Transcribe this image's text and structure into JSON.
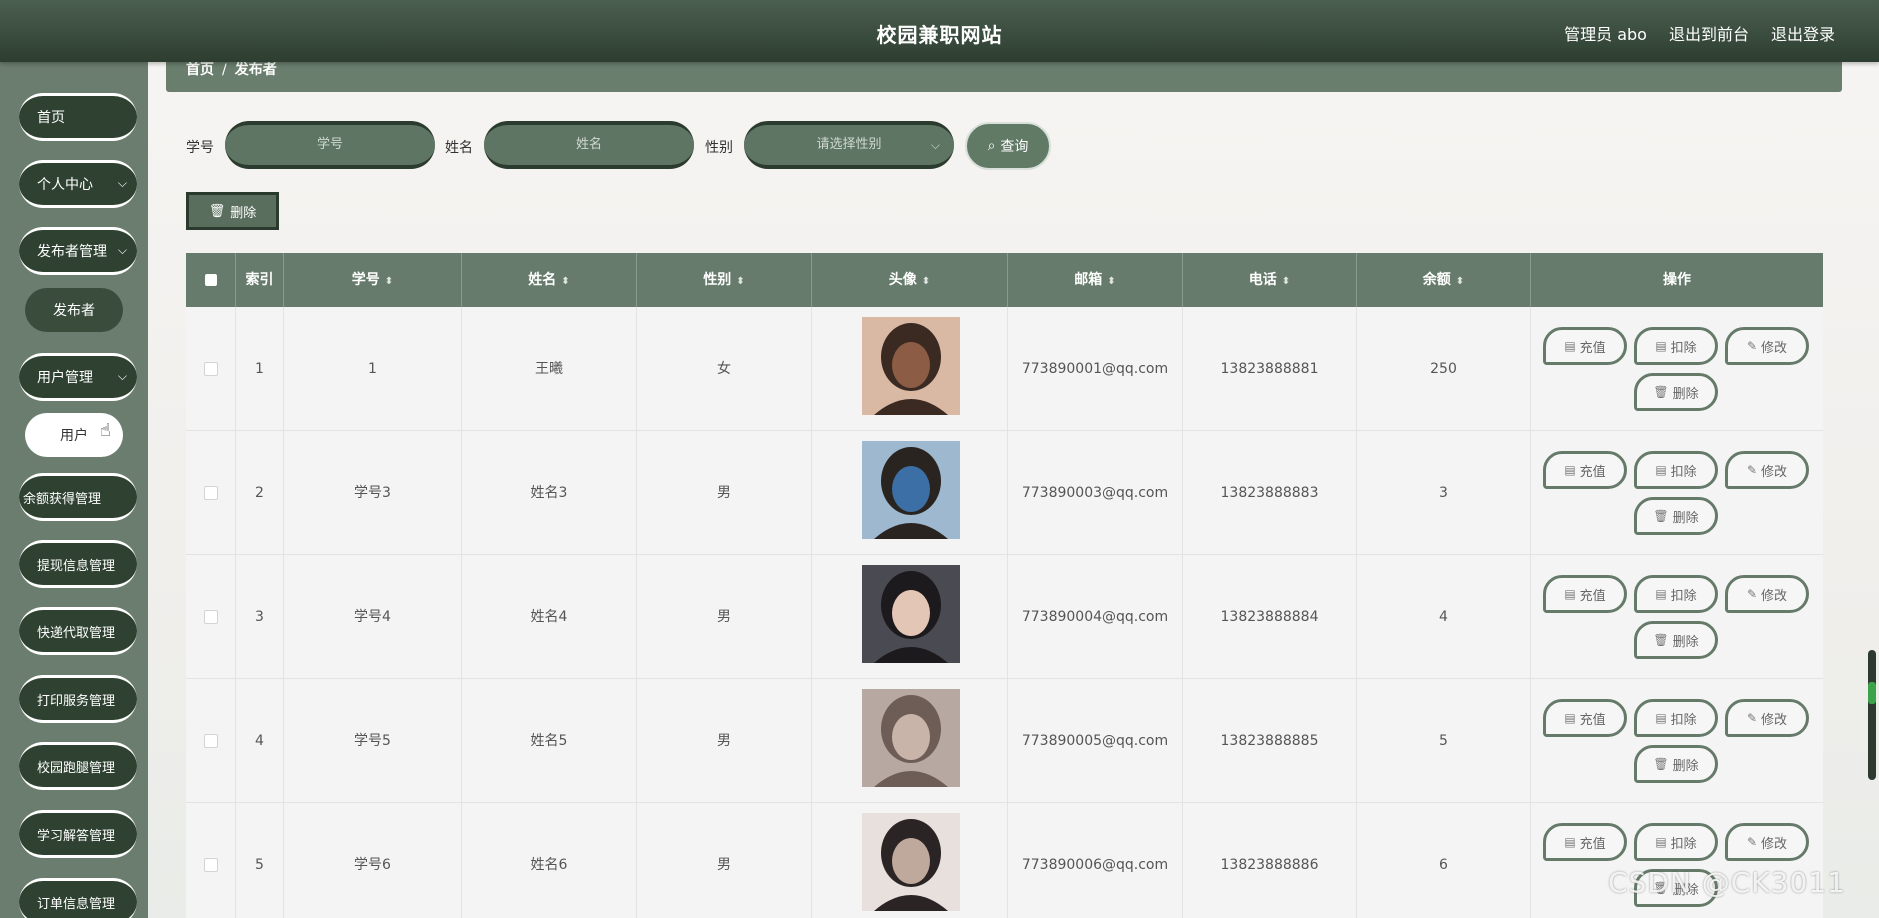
{
  "header": {
    "site_title": "校园兼职网站",
    "admin_label": "管理员 abo",
    "to_front": "退出到前台",
    "logout": "退出登录"
  },
  "sidebar": {
    "items": [
      {
        "label": "首页"
      },
      {
        "label": "个人中心"
      },
      {
        "label": "发布者管理"
      },
      {
        "label": "发布者"
      },
      {
        "label": "用户管理"
      },
      {
        "label": "用户"
      },
      {
        "label": "余额获得管理"
      },
      {
        "label": "提现信息管理"
      },
      {
        "label": "快递代取管理"
      },
      {
        "label": "打印服务管理"
      },
      {
        "label": "校园跑腿管理"
      },
      {
        "label": "学习解答管理"
      },
      {
        "label": "订单信息管理"
      }
    ]
  },
  "breadcrumb": {
    "home": "首页",
    "sep": "/",
    "current": "发布者"
  },
  "search": {
    "xuehao_label": "学号",
    "xuehao_placeholder": "学号",
    "xingming_label": "姓名",
    "xingming_placeholder": "姓名",
    "xingbie_label": "性别",
    "xingbie_placeholder": "请选择性别",
    "query_label": "查询"
  },
  "toolbar": {
    "delete_label": "删除"
  },
  "table": {
    "columns": [
      "索引",
      "学号",
      "姓名",
      "性别",
      "头像",
      "邮箱",
      "电话",
      "余额",
      "操作"
    ],
    "rows": [
      {
        "index": "1",
        "xuehao": "1",
        "name": "王曦",
        "gender": "女",
        "email": "773890001@qq.com",
        "phone": "13823888881",
        "balance": "250"
      },
      {
        "index": "2",
        "xuehao": "学号3",
        "name": "姓名3",
        "gender": "男",
        "email": "773890003@qq.com",
        "phone": "13823888883",
        "balance": "3"
      },
      {
        "index": "3",
        "xuehao": "学号4",
        "name": "姓名4",
        "gender": "男",
        "email": "773890004@qq.com",
        "phone": "13823888884",
        "balance": "4"
      },
      {
        "index": "4",
        "xuehao": "学号5",
        "name": "姓名5",
        "gender": "男",
        "email": "773890005@qq.com",
        "phone": "13823888885",
        "balance": "5"
      },
      {
        "index": "5",
        "xuehao": "学号6",
        "name": "姓名6",
        "gender": "男",
        "email": "773890006@qq.com",
        "phone": "13823888886",
        "balance": "6"
      }
    ],
    "ops": {
      "recharge": "充值",
      "deduct": "扣除",
      "edit": "修改",
      "delete": "删除"
    }
  },
  "watermark": "CSDN @CK3011",
  "colors": {
    "header": "#2d3e31",
    "sidebar": "#6b7d6e",
    "accent": "#667b6b"
  }
}
